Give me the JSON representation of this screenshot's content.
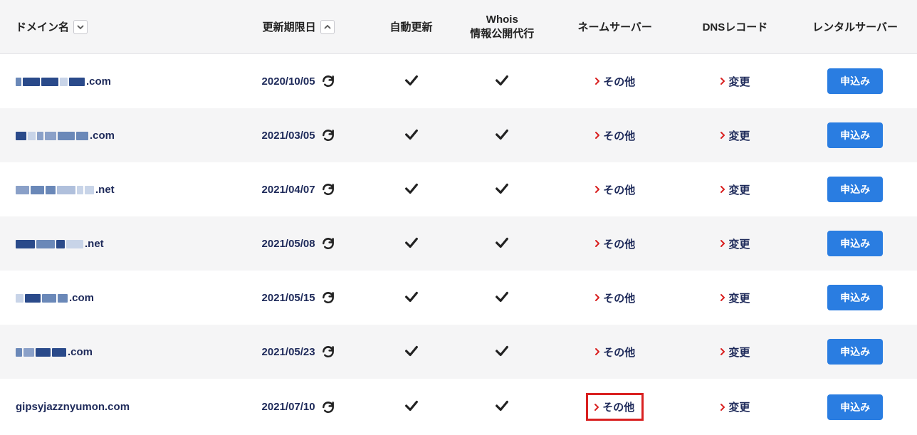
{
  "header": {
    "domain": "ドメイン名",
    "expiry": "更新期限日",
    "auto_update": "自動更新",
    "whois_line1": "Whois",
    "whois_line2": "情報公開代行",
    "nameserver": "ネームサーバー",
    "dns_record": "DNSレコード",
    "rental_server": "レンタルサーバー"
  },
  "labels": {
    "other": "その他",
    "change": "変更",
    "apply": "申込み"
  },
  "rows": [
    {
      "domain_suffix": ".com",
      "censored": true,
      "expiry": "2020/10/05",
      "auto": true,
      "whois": true,
      "highlight_ns": false
    },
    {
      "domain_suffix": ".com",
      "censored": true,
      "expiry": "2021/03/05",
      "auto": true,
      "whois": true,
      "highlight_ns": false
    },
    {
      "domain_suffix": ".net",
      "censored": true,
      "expiry": "2021/04/07",
      "auto": true,
      "whois": true,
      "highlight_ns": false
    },
    {
      "domain_suffix": ".net",
      "censored": true,
      "expiry": "2021/05/08",
      "auto": true,
      "whois": true,
      "highlight_ns": false
    },
    {
      "domain_suffix": ".com",
      "censored": true,
      "expiry": "2021/05/15",
      "auto": true,
      "whois": true,
      "highlight_ns": false
    },
    {
      "domain_suffix": ".com",
      "censored": true,
      "expiry": "2021/05/23",
      "auto": true,
      "whois": true,
      "highlight_ns": false
    },
    {
      "domain_suffix": "gipsyjazznyumon.com",
      "censored": false,
      "expiry": "2021/07/10",
      "auto": true,
      "whois": true,
      "highlight_ns": true
    }
  ]
}
